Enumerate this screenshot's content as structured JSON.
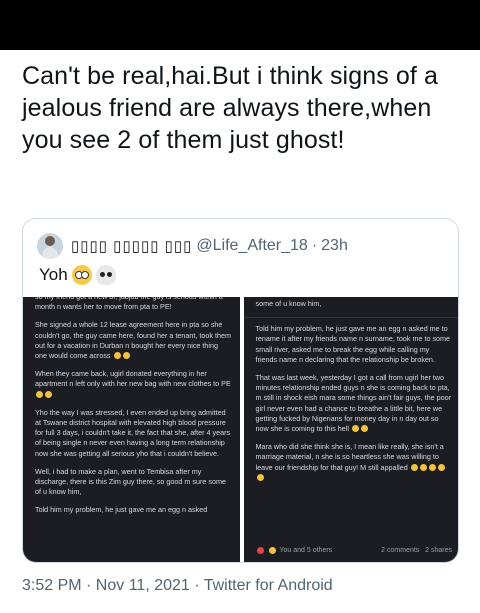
{
  "tweet": {
    "text": "Can't be real,hai.But i think signs of a jealous friend are always there,when you see 2 of them just ghost!",
    "timestamp": "3:52 PM · Nov 11, 2021 · Twitter for Android"
  },
  "quote": {
    "display_name": "▯▯▯▯ ▯▯▯▯▯ ▯▯▯",
    "handle": "@Life_After_18",
    "separator": "·",
    "time": "23h",
    "text": "Yoh",
    "emojis": [
      "flushed-face-icon",
      "skull-icon"
    ]
  },
  "screenshot_left": {
    "paragraphs": [
      "so my friend got a new bf, jabjab the guy is serious within a month n wants her to move from pta to PE!",
      "She signed a whole 12 lease agreement here in pta so she couldn't go, the guy came here, found her a tenant, took them out for a vacation in Durban n bought her every nice thing one would come across",
      "When they came back, ugirl donated everything in her apartment n left only with her new bag with new clothes to PE",
      "Yho the way I was stressed, I even ended up bring admitted at Tswane district hospital with elevated high blood pressure for full 3 days, i couldn't take it, the fact that she, after 4 years of being single n never even having a long term relationship now she was getting all serious yho that i couldn't believe.",
      "Well, i had to make a plan, went to Tembisa after my discharge, there is this Zim guy there, so good m sure some of u know him,",
      "Told him my problem, he just gave me an egg n asked"
    ]
  },
  "screenshot_right": {
    "top_line": "some of u know him,",
    "paragraphs": [
      "Told him my problem, he just gave me an egg n asked me to rename it after my friends name n surname, took me to some small river, asked me to break the egg while calling my friends name n declaring that the relationship be broken.",
      "That was last week, yesterday I got a call from ugirl her two minutes relationship ended guys n she is coming back to pta, m still in shock eish mara some things ain't fair guys, the poor girl never even had a chance to breathe a little bit, here we getting fucked by Nigerians for money day in n day out so now she is coming to this hell",
      "Mara who did she think she is, I mean like really, she isn't a marriage material, n she is so heartless she was willing to leave our friendship for that guy! M still appalled"
    ],
    "reactions": "You and 5 others",
    "comments": "2 comments",
    "shares": "2 shares"
  },
  "colors": {
    "background": "#ffffff",
    "text": "#0f1419",
    "secondary": "#536471",
    "card_border": "#cfd9de",
    "screenshot_bg": "#1b1d22"
  }
}
